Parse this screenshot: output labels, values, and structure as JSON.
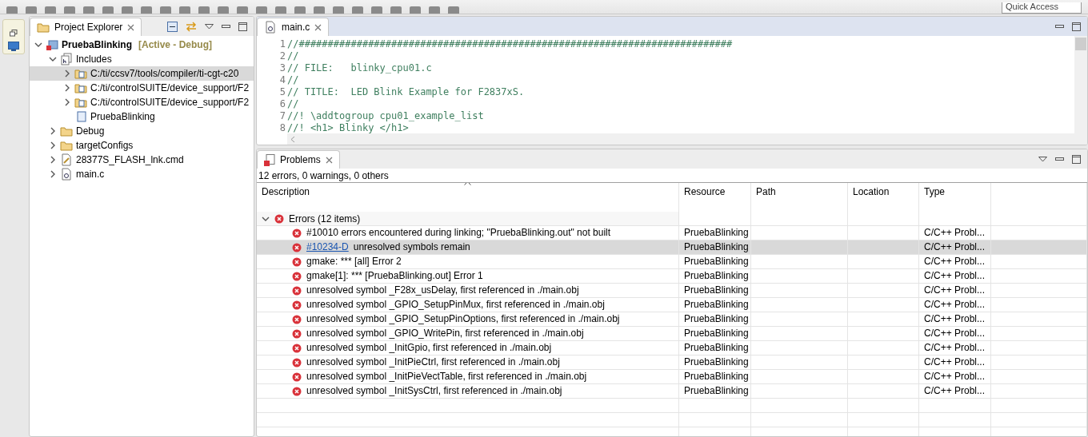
{
  "toolbar": {
    "quick_access": "Quick Access"
  },
  "project_explorer": {
    "title": "Project Explorer",
    "tree": [
      {
        "label": "PruebaBlinking",
        "decoration": "[Active - Debug]",
        "kind": "project",
        "expanded": true,
        "selected": false,
        "children": [
          {
            "label": "Includes",
            "kind": "includes",
            "expanded": true,
            "selected": false,
            "children": [
              {
                "label": "C:/ti/ccsv7/tools/compiler/ti-cgt-c20",
                "kind": "include-path",
                "expanded": false,
                "selected": true
              },
              {
                "label": "C:/ti/controlSUITE/device_support/F2",
                "kind": "include-path",
                "expanded": false,
                "selected": false
              },
              {
                "label": "C:/ti/controlSUITE/device_support/F2",
                "kind": "include-path",
                "expanded": false,
                "selected": false
              },
              {
                "label": "PruebaBlinking",
                "kind": "include-local",
                "selected": false
              }
            ]
          },
          {
            "label": "Debug",
            "kind": "folder",
            "expanded": false,
            "selected": false
          },
          {
            "label": "targetConfigs",
            "kind": "folder",
            "expanded": false,
            "selected": false
          },
          {
            "label": "28377S_FLASH_lnk.cmd",
            "kind": "linker-file",
            "expanded": false,
            "selected": false
          },
          {
            "label": "main.c",
            "kind": "c-file",
            "expanded": false,
            "selected": false
          }
        ]
      }
    ]
  },
  "editor": {
    "tab": "main.c",
    "lines": [
      {
        "number": "1",
        "text": "//###########################################################################"
      },
      {
        "number": "2",
        "text": "//"
      },
      {
        "number": "3",
        "text": "// FILE:   blinky_cpu01.c"
      },
      {
        "number": "4",
        "text": "//"
      },
      {
        "number": "5",
        "text": "// TITLE:  LED Blink Example for F2837xS."
      },
      {
        "number": "6",
        "text": "//"
      },
      {
        "number": "7",
        "text": "//! \\addtogroup cpu01_example_list"
      },
      {
        "number": "8",
        "text": "//! <h1> Blinky </h1>"
      }
    ]
  },
  "problems": {
    "title": "Problems",
    "summary": "12 errors, 0 warnings, 0 others",
    "columns": [
      "Description",
      "Resource",
      "Path",
      "Location",
      "Type"
    ],
    "group": {
      "label": "Errors (12 items)",
      "expanded": true
    },
    "rows": [
      {
        "description": "#10010 errors encountered during linking; \"PruebaBlinking.out\" not built",
        "resource": "PruebaBlinking",
        "type": "C/C++ Probl...",
        "selected": false
      },
      {
        "link": "#10234-D",
        "description": "unresolved symbols remain",
        "resource": "PruebaBlinking",
        "type": "C/C++ Probl...",
        "selected": true
      },
      {
        "description": "gmake: *** [all] Error 2",
        "resource": "PruebaBlinking",
        "type": "C/C++ Probl...",
        "selected": false
      },
      {
        "description": "gmake[1]: *** [PruebaBlinking.out] Error 1",
        "resource": "PruebaBlinking",
        "type": "C/C++ Probl...",
        "selected": false
      },
      {
        "description": "unresolved symbol _F28x_usDelay, first referenced in ./main.obj",
        "resource": "PruebaBlinking",
        "type": "C/C++ Probl...",
        "selected": false
      },
      {
        "description": "unresolved symbol _GPIO_SetupPinMux, first referenced in ./main.obj",
        "resource": "PruebaBlinking",
        "type": "C/C++ Probl...",
        "selected": false
      },
      {
        "description": "unresolved symbol _GPIO_SetupPinOptions, first referenced in ./main.obj",
        "resource": "PruebaBlinking",
        "type": "C/C++ Probl...",
        "selected": false
      },
      {
        "description": "unresolved symbol _GPIO_WritePin, first referenced in ./main.obj",
        "resource": "PruebaBlinking",
        "type": "C/C++ Probl...",
        "selected": false
      },
      {
        "description": "unresolved symbol _InitGpio, first referenced in ./main.obj",
        "resource": "PruebaBlinking",
        "type": "C/C++ Probl...",
        "selected": false
      },
      {
        "description": "unresolved symbol _InitPieCtrl, first referenced in ./main.obj",
        "resource": "PruebaBlinking",
        "type": "C/C++ Probl...",
        "selected": false
      },
      {
        "description": "unresolved symbol _InitPieVectTable, first referenced in ./main.obj",
        "resource": "PruebaBlinking",
        "type": "C/C++ Probl...",
        "selected": false
      },
      {
        "description": "unresolved symbol _InitSysCtrl, first referenced in ./main.obj",
        "resource": "PruebaBlinking",
        "type": "C/C++ Probl...",
        "selected": false
      }
    ]
  }
}
